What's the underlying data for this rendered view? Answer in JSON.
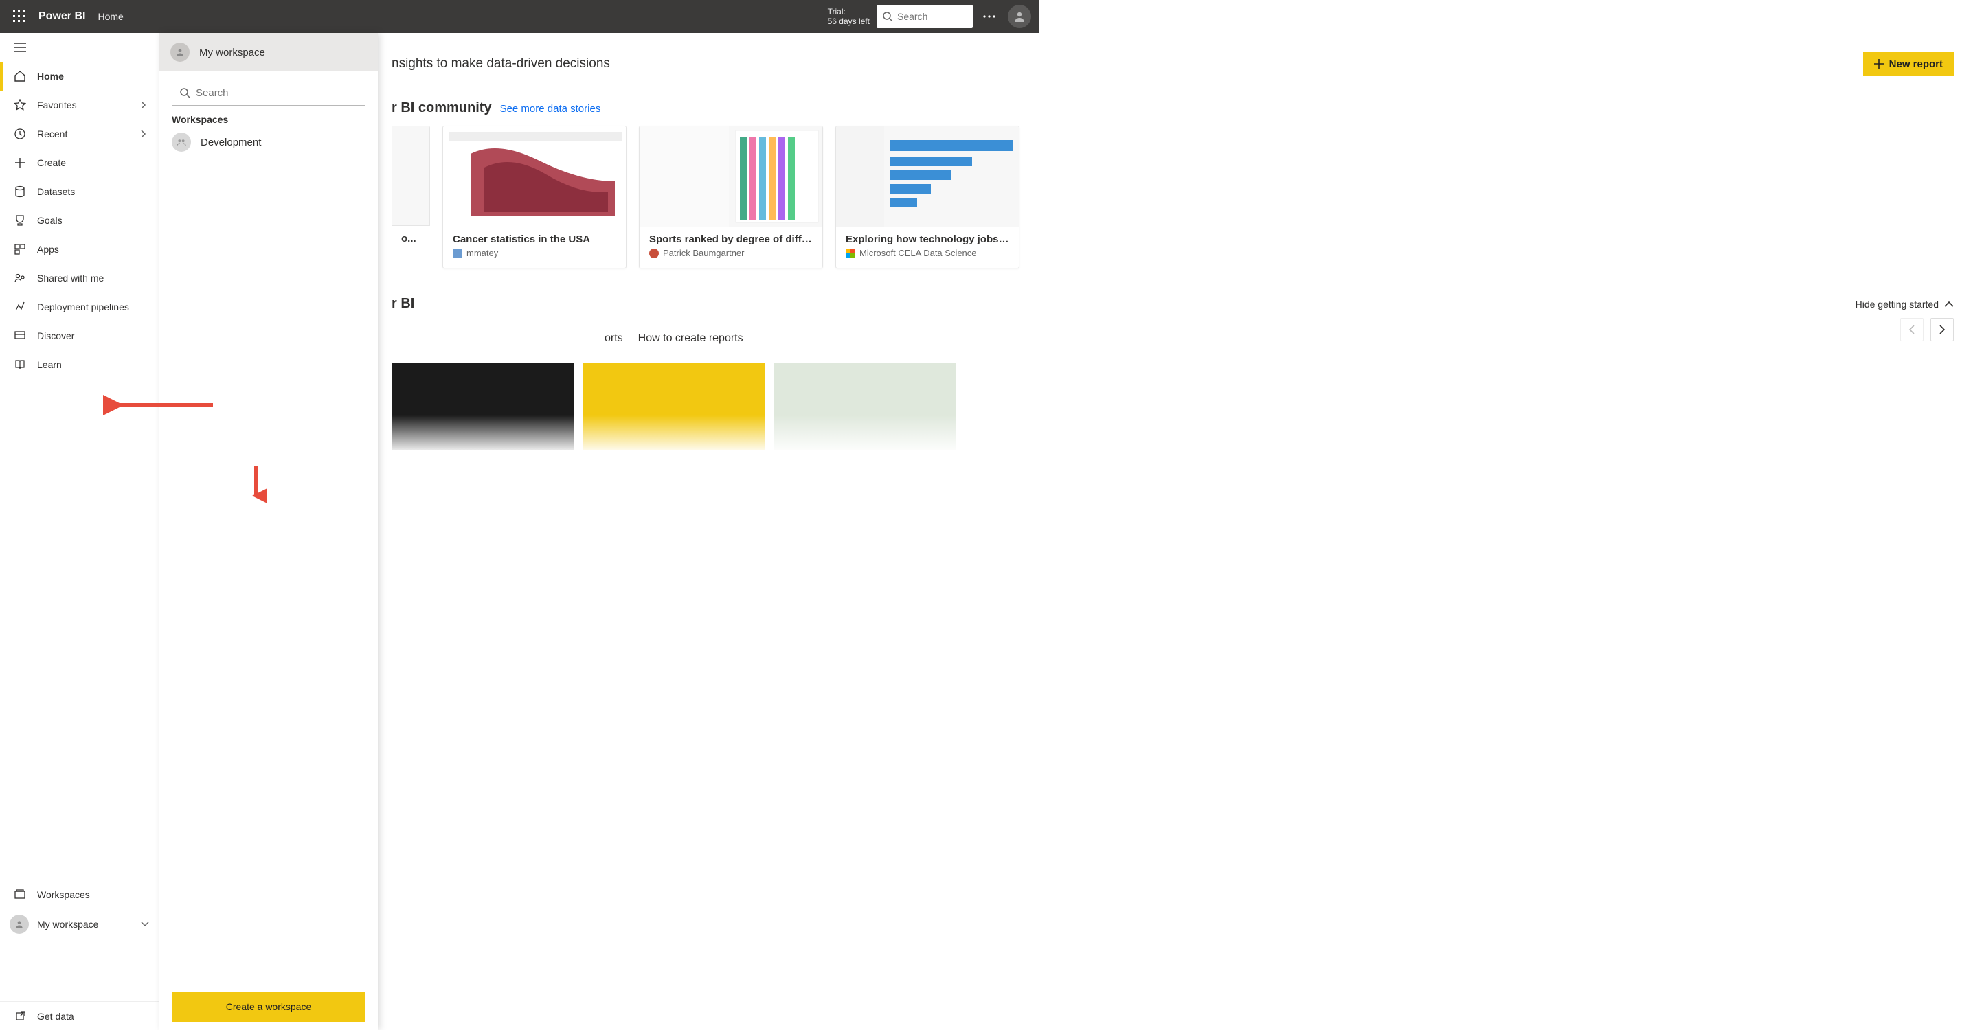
{
  "topbar": {
    "brand": "Power BI",
    "breadcrumb": "Home",
    "trial_line1": "Trial:",
    "trial_line2": "56 days left",
    "search_placeholder": "Search"
  },
  "leftnav": {
    "items": [
      {
        "label": "Home",
        "icon": "home-icon",
        "active": true
      },
      {
        "label": "Favorites",
        "icon": "star-icon",
        "chevron": true
      },
      {
        "label": "Recent",
        "icon": "clock-icon",
        "chevron": true
      },
      {
        "label": "Create",
        "icon": "plus-icon"
      },
      {
        "label": "Datasets",
        "icon": "dataset-icon"
      },
      {
        "label": "Goals",
        "icon": "trophy-icon"
      },
      {
        "label": "Apps",
        "icon": "apps-icon"
      },
      {
        "label": "Shared with me",
        "icon": "shared-icon"
      },
      {
        "label": "Deployment pipelines",
        "icon": "pipeline-icon"
      },
      {
        "label": "Discover",
        "icon": "discover-icon"
      },
      {
        "label": "Learn",
        "icon": "learn-icon"
      }
    ],
    "workspaces_label": "Workspaces",
    "my_workspace_label": "My workspace",
    "get_data_label": "Get data"
  },
  "flyout": {
    "header": "My workspace",
    "search_placeholder": "Search",
    "section_label": "Workspaces",
    "items": [
      {
        "label": "Development"
      }
    ],
    "create_button": "Create a workspace"
  },
  "main": {
    "tagline_fragment": "nsights to make data-driven decisions",
    "new_report_button": "New report",
    "community": {
      "title_fragment": "r BI community",
      "link": "See more data stories",
      "cards": [
        {
          "title": "o...",
          "author": ""
        },
        {
          "title": "Cancer statistics in the USA",
          "author": "mmatey",
          "author_icon_color": "#6b9bd1"
        },
        {
          "title": "Sports ranked by degree of diffi...",
          "author": "Patrick Baumgartner",
          "author_icon_color": "#c84f3a"
        },
        {
          "title": "Exploring how technology jobs ...",
          "author": "Microsoft CELA Data Science",
          "author_icon_color": "#0078d4"
        }
      ]
    },
    "learn": {
      "title_fragment": "r BI",
      "hide_label": "Hide getting started",
      "tabs": [
        "orts",
        "How to create reports"
      ]
    }
  }
}
